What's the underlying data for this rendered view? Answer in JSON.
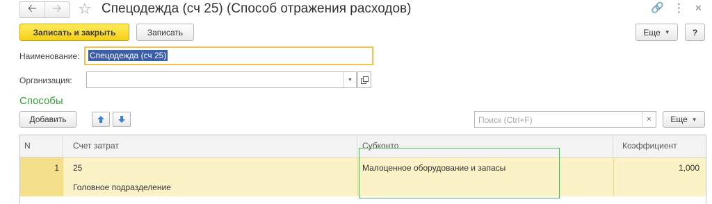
{
  "window": {
    "title": "Спецодежда (сч 25) (Способ отражения расходов)",
    "back_glyph": "🡠",
    "forward_glyph": "🡢",
    "favorite_glyph": "☆",
    "link_glyph": "🔗",
    "menu_glyph": "⋮",
    "close_glyph": "✕"
  },
  "toolbar": {
    "save_close_label": "Записать и закрыть",
    "save_label": "Записать",
    "more_label": "Еще",
    "help_label": "?"
  },
  "form": {
    "name_label": "Наименование:",
    "name_value": "Спецодежда (сч 25)",
    "org_label": "Организация:",
    "org_value": ""
  },
  "methods": {
    "section_title": "Способы",
    "add_label": "Добавить",
    "search_placeholder": "Поиск (Ctrl+F)",
    "clear_glyph": "×",
    "more_label": "Еще"
  },
  "table": {
    "columns": [
      "N",
      "Счет затрат",
      "Субконто",
      "Коэффициент"
    ],
    "rows": [
      {
        "n": "1",
        "account": "25",
        "department": "Головное подразделение",
        "subconto": "Малоценное оборудование и запасы",
        "coefficient": "1,000"
      }
    ]
  },
  "colors": {
    "primary_button": "#f5cf17",
    "section_title": "#3ba13b",
    "selected_row": "#fbf2c8",
    "selected_row_number": "#f4df8a",
    "highlight_border": "#5aa85a"
  },
  "icons": [
    "back-arrow-icon",
    "forward-arrow-icon",
    "star-icon",
    "link-icon",
    "more-vertical-icon",
    "close-icon",
    "chevron-down-icon",
    "open-icon",
    "arrow-up-icon",
    "arrow-down-icon",
    "clear-icon"
  ]
}
